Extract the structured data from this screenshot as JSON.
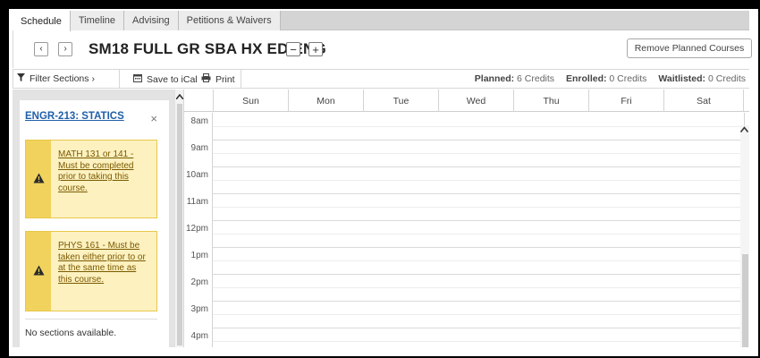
{
  "tabs": [
    {
      "label": "Schedule",
      "active": true
    },
    {
      "label": "Timeline",
      "active": false
    },
    {
      "label": "Advising",
      "active": false
    },
    {
      "label": "Petitions & Waivers",
      "active": false
    }
  ],
  "term": {
    "prev_icon": "‹",
    "next_icon": "›",
    "title": "SM18 FULL GR SBA HX ED ENG",
    "collapse_icon": "−",
    "expand_icon": "+",
    "remove_label": "Remove Planned Courses"
  },
  "toolbar": {
    "filter_icon": "filter-icon",
    "filter_label": "Filter Sections ›",
    "save_icon": "calendar-icon",
    "save_label": "Save to iCal",
    "print_icon": "printer-icon",
    "print_label": "Print",
    "planned_label": "Planned:",
    "planned_value": "6 Credits",
    "enrolled_label": "Enrolled:",
    "enrolled_value": "0 Credits",
    "waitlisted_label": "Waitlisted:",
    "waitlisted_value": "0 Credits"
  },
  "course": {
    "name": "ENGR-213: STATICS",
    "close_icon": "×",
    "prereqs": [
      {
        "text": "MATH 131 or 141 - Must be completed prior to taking this course."
      },
      {
        "text": "PHYS 161 - Must be taken either prior to or at the same time as this course."
      }
    ],
    "no_sections": "No sections available."
  },
  "calendar": {
    "days": [
      "Sun",
      "Mon",
      "Tue",
      "Wed",
      "Thu",
      "Fri",
      "Sat"
    ],
    "hours": [
      "8am",
      "9am",
      "10am",
      "11am",
      "12pm",
      "1pm",
      "2pm",
      "3pm",
      "4pm"
    ]
  },
  "colors": {
    "link": "#1f5ea8",
    "warning_bg": "#fdf1c0",
    "warning_band": "#f1d25d",
    "warning_text": "#7a5a00"
  }
}
